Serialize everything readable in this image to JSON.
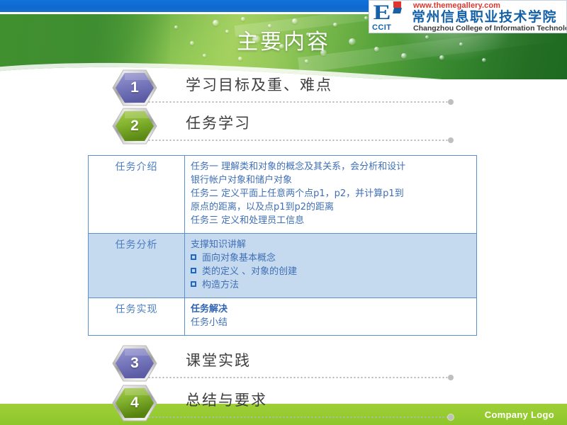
{
  "slide": {
    "title": "主要内容"
  },
  "logo": {
    "mark_letter": "E",
    "abbr": "CCIT",
    "url": "www.themegallery.com",
    "name_cn": "常州信息职业技术学院",
    "name_en": "Changzhou College of Information Technology"
  },
  "agenda": [
    {
      "number": "1",
      "label": "学习目标及重、难点",
      "color": "purple"
    },
    {
      "number": "2",
      "label": "任务学习",
      "color": "green"
    },
    {
      "number": "3",
      "label": "课堂实践",
      "color": "purple"
    },
    {
      "number": "4",
      "label": "总结与要求",
      "color": "green"
    }
  ],
  "table": {
    "rows": [
      {
        "label": "任务介绍",
        "lines": [
          "任务一  理解类和对象的概念及其关系，会分析和设计",
          "银行帐户对象和储户对象",
          "任务二  定义平面上任意两个点p1，p2，并计算p1到",
          "原点的距离，以及点p1到p2的距离",
          "任务三   定义和处理员工信息"
        ]
      },
      {
        "label": "任务分析",
        "heading": "支撑知识讲解",
        "bullets": [
          "面向对象基本概念",
          "类的定义 、对象的创建",
          "构造方法"
        ]
      },
      {
        "label": "任务实现",
        "strong_line": "任务解决",
        "plain_line": "任务小结"
      }
    ]
  },
  "footer": {
    "company_logo": "Company Logo"
  },
  "colors": {
    "top_bar_blue": "#1271d8",
    "band_green": "#96cb30",
    "table_border": "#5b8fd0",
    "table_text": "#3f6fb5",
    "table_shaded_bg": "#c6daef",
    "hex_purple": "#6f6fb4",
    "hex_green": "#70a521",
    "logo_blue": "#1461a8",
    "logo_red": "#e2342c"
  }
}
